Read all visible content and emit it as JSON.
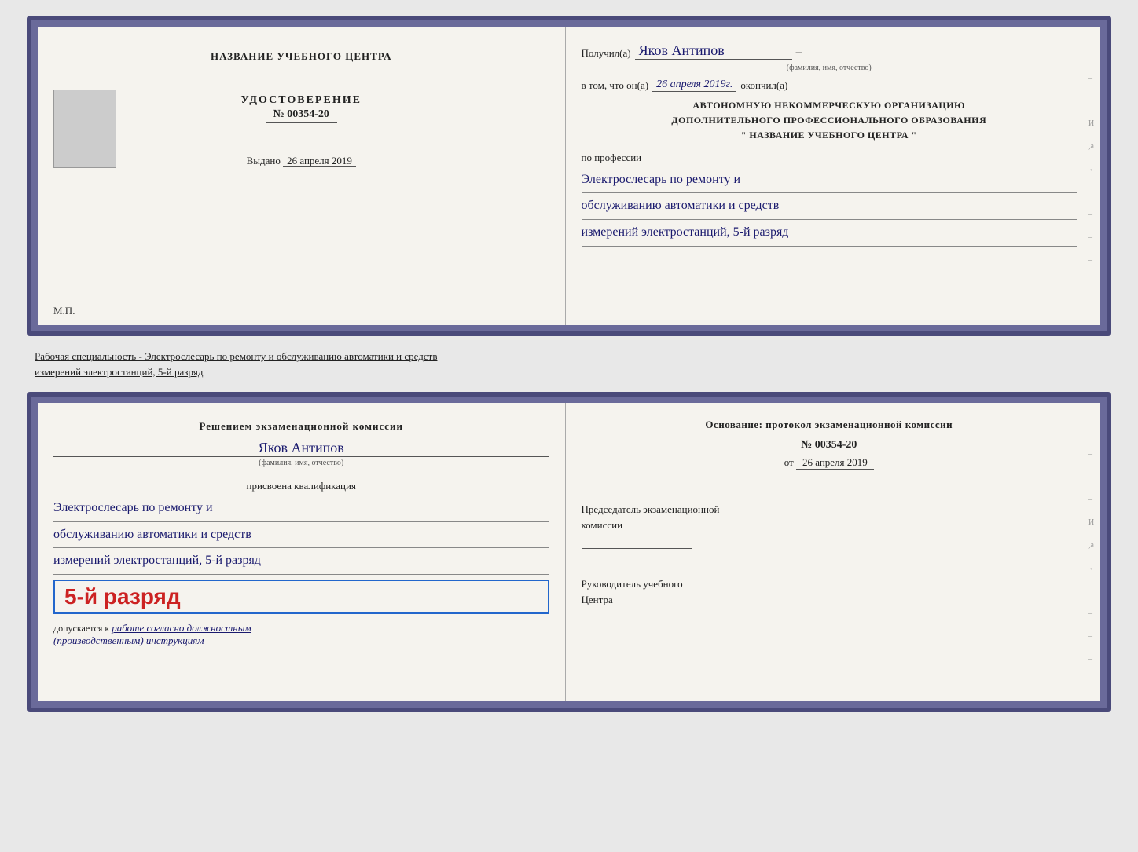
{
  "doc1": {
    "left": {
      "center_title": "НАЗВАНИЕ УЧЕБНОГО ЦЕНТРА",
      "udostoverenie_label": "УДОСТОВЕРЕНИЕ",
      "number": "№ 00354-20",
      "vydano_label": "Выдано",
      "vydano_date": "26 апреля 2019",
      "mp_label": "М.П."
    },
    "right": {
      "poluchil_label": "Получил(а)",
      "recipient_name": "Яков Антипов",
      "fio_subtitle": "(фамилия, имя, отчество)",
      "vtom_label": "в том, что он(а)",
      "vtom_date": "26 апреля 2019г.",
      "okonchil_label": "окончил(а)",
      "org_line1": "АВТОНОМНУЮ НЕКОММЕРЧЕСКУЮ ОРГАНИЗАЦИЮ",
      "org_line2": "ДОПОЛНИТЕЛЬНОГО ПРОФЕССИОНАЛЬНОГО ОБРАЗОВАНИЯ",
      "org_line3": "\"  НАЗВАНИЕ УЧЕБНОГО ЦЕНТРА  \"",
      "po_professii": "по профессии",
      "profession_line1": "Электрослесарь по ремонту и",
      "profession_line2": "обслуживанию автоматики и средств",
      "profession_line3": "измерений электростанций, 5-й разряд"
    }
  },
  "separator": {
    "line1": "Рабочая специальность - Электрослесарь по ремонту и обслуживанию автоматики и средств",
    "line2": "измерений электростанций, 5-й разряд"
  },
  "doc2": {
    "left": {
      "reshenie_title": "Решением экзаменационной комиссии",
      "name": "Яков Антипов",
      "fio_subtitle": "(фамилия, имя, отчество)",
      "prisvoena": "присвоена квалификация",
      "kval_line1": "Электрослесарь по ремонту и",
      "kval_line2": "обслуживанию автоматики и средств",
      "kval_line3": "измерений электростанций, 5-й разряд",
      "razryad_badge": "5-й разряд",
      "dopuskaetsya": "допускается к",
      "dopusk_value": "работе согласно должностным",
      "dopusk_value2": "(производственным) инструкциям"
    },
    "right": {
      "osnovanie_label": "Основание: протокол экзаменационной комиссии",
      "proto_number": "№  00354-20",
      "ot_label": "от",
      "ot_date": "26 апреля 2019",
      "predsedatel_title": "Председатель экзаменационной",
      "komissia_label": "комиссии",
      "rukovoditel_title": "Руководитель учебного",
      "tsentr_label": "Центра"
    }
  }
}
